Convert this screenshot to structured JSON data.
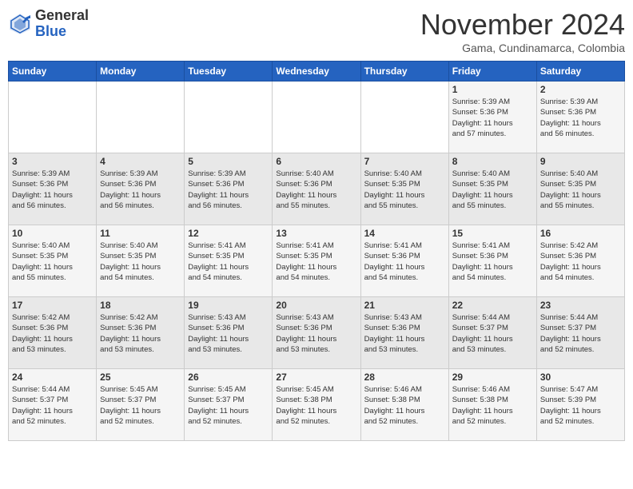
{
  "header": {
    "logo_line1": "General",
    "logo_line2": "Blue",
    "month": "November 2024",
    "location": "Gama, Cundinamarca, Colombia"
  },
  "days_of_week": [
    "Sunday",
    "Monday",
    "Tuesday",
    "Wednesday",
    "Thursday",
    "Friday",
    "Saturday"
  ],
  "weeks": [
    [
      {
        "day": "",
        "info": ""
      },
      {
        "day": "",
        "info": ""
      },
      {
        "day": "",
        "info": ""
      },
      {
        "day": "",
        "info": ""
      },
      {
        "day": "",
        "info": ""
      },
      {
        "day": "1",
        "info": "Sunrise: 5:39 AM\nSunset: 5:36 PM\nDaylight: 11 hours\nand 57 minutes."
      },
      {
        "day": "2",
        "info": "Sunrise: 5:39 AM\nSunset: 5:36 PM\nDaylight: 11 hours\nand 56 minutes."
      }
    ],
    [
      {
        "day": "3",
        "info": "Sunrise: 5:39 AM\nSunset: 5:36 PM\nDaylight: 11 hours\nand 56 minutes."
      },
      {
        "day": "4",
        "info": "Sunrise: 5:39 AM\nSunset: 5:36 PM\nDaylight: 11 hours\nand 56 minutes."
      },
      {
        "day": "5",
        "info": "Sunrise: 5:39 AM\nSunset: 5:36 PM\nDaylight: 11 hours\nand 56 minutes."
      },
      {
        "day": "6",
        "info": "Sunrise: 5:40 AM\nSunset: 5:36 PM\nDaylight: 11 hours\nand 55 minutes."
      },
      {
        "day": "7",
        "info": "Sunrise: 5:40 AM\nSunset: 5:35 PM\nDaylight: 11 hours\nand 55 minutes."
      },
      {
        "day": "8",
        "info": "Sunrise: 5:40 AM\nSunset: 5:35 PM\nDaylight: 11 hours\nand 55 minutes."
      },
      {
        "day": "9",
        "info": "Sunrise: 5:40 AM\nSunset: 5:35 PM\nDaylight: 11 hours\nand 55 minutes."
      }
    ],
    [
      {
        "day": "10",
        "info": "Sunrise: 5:40 AM\nSunset: 5:35 PM\nDaylight: 11 hours\nand 55 minutes."
      },
      {
        "day": "11",
        "info": "Sunrise: 5:40 AM\nSunset: 5:35 PM\nDaylight: 11 hours\nand 54 minutes."
      },
      {
        "day": "12",
        "info": "Sunrise: 5:41 AM\nSunset: 5:35 PM\nDaylight: 11 hours\nand 54 minutes."
      },
      {
        "day": "13",
        "info": "Sunrise: 5:41 AM\nSunset: 5:35 PM\nDaylight: 11 hours\nand 54 minutes."
      },
      {
        "day": "14",
        "info": "Sunrise: 5:41 AM\nSunset: 5:36 PM\nDaylight: 11 hours\nand 54 minutes."
      },
      {
        "day": "15",
        "info": "Sunrise: 5:41 AM\nSunset: 5:36 PM\nDaylight: 11 hours\nand 54 minutes."
      },
      {
        "day": "16",
        "info": "Sunrise: 5:42 AM\nSunset: 5:36 PM\nDaylight: 11 hours\nand 54 minutes."
      }
    ],
    [
      {
        "day": "17",
        "info": "Sunrise: 5:42 AM\nSunset: 5:36 PM\nDaylight: 11 hours\nand 53 minutes."
      },
      {
        "day": "18",
        "info": "Sunrise: 5:42 AM\nSunset: 5:36 PM\nDaylight: 11 hours\nand 53 minutes."
      },
      {
        "day": "19",
        "info": "Sunrise: 5:43 AM\nSunset: 5:36 PM\nDaylight: 11 hours\nand 53 minutes."
      },
      {
        "day": "20",
        "info": "Sunrise: 5:43 AM\nSunset: 5:36 PM\nDaylight: 11 hours\nand 53 minutes."
      },
      {
        "day": "21",
        "info": "Sunrise: 5:43 AM\nSunset: 5:36 PM\nDaylight: 11 hours\nand 53 minutes."
      },
      {
        "day": "22",
        "info": "Sunrise: 5:44 AM\nSunset: 5:37 PM\nDaylight: 11 hours\nand 53 minutes."
      },
      {
        "day": "23",
        "info": "Sunrise: 5:44 AM\nSunset: 5:37 PM\nDaylight: 11 hours\nand 52 minutes."
      }
    ],
    [
      {
        "day": "24",
        "info": "Sunrise: 5:44 AM\nSunset: 5:37 PM\nDaylight: 11 hours\nand 52 minutes."
      },
      {
        "day": "25",
        "info": "Sunrise: 5:45 AM\nSunset: 5:37 PM\nDaylight: 11 hours\nand 52 minutes."
      },
      {
        "day": "26",
        "info": "Sunrise: 5:45 AM\nSunset: 5:37 PM\nDaylight: 11 hours\nand 52 minutes."
      },
      {
        "day": "27",
        "info": "Sunrise: 5:45 AM\nSunset: 5:38 PM\nDaylight: 11 hours\nand 52 minutes."
      },
      {
        "day": "28",
        "info": "Sunrise: 5:46 AM\nSunset: 5:38 PM\nDaylight: 11 hours\nand 52 minutes."
      },
      {
        "day": "29",
        "info": "Sunrise: 5:46 AM\nSunset: 5:38 PM\nDaylight: 11 hours\nand 52 minutes."
      },
      {
        "day": "30",
        "info": "Sunrise: 5:47 AM\nSunset: 5:39 PM\nDaylight: 11 hours\nand 52 minutes."
      }
    ]
  ]
}
